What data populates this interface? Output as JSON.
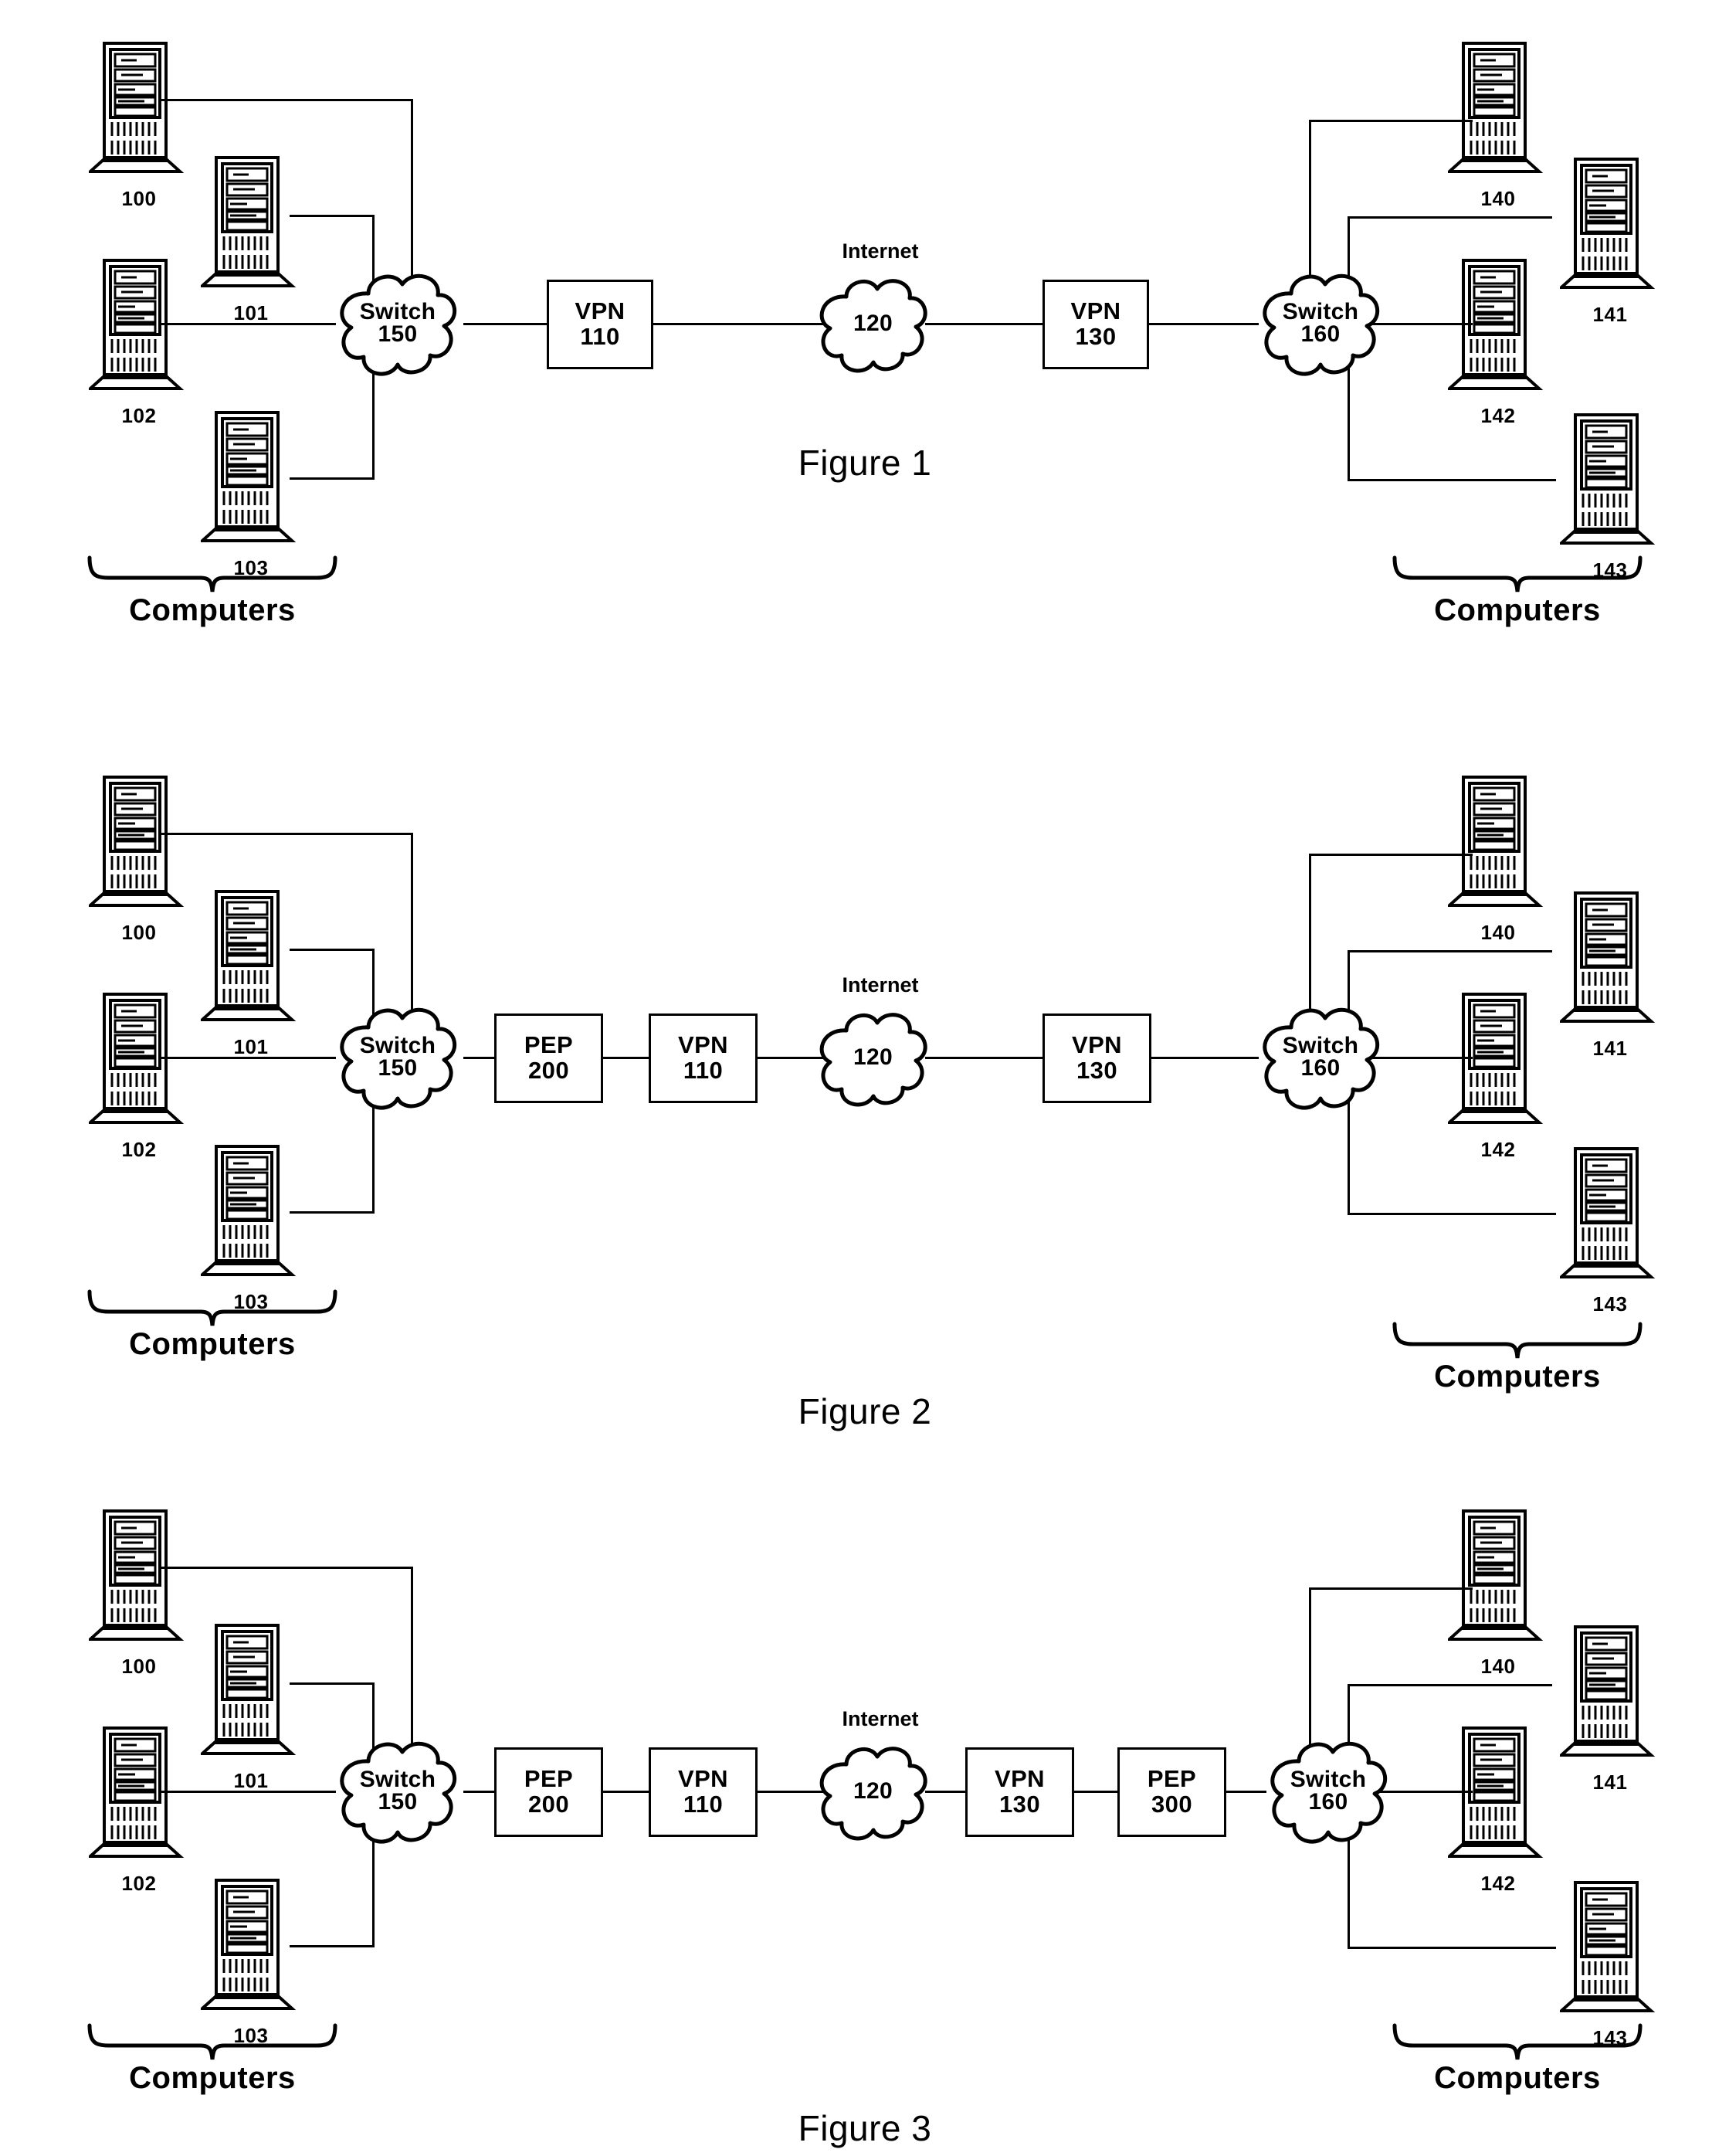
{
  "document": {
    "type": "patent-figure-sheet",
    "figure_count": 3
  },
  "labels": {
    "computers_group": "Computers",
    "internet_caption": "Internet",
    "switch_word": "Switch",
    "vpn_word": "VPN",
    "pep_word": "PEP"
  },
  "figures": [
    {
      "id": "fig1",
      "caption": "Figure 1",
      "left_computers": [
        {
          "ref": "100"
        },
        {
          "ref": "101"
        },
        {
          "ref": "102"
        },
        {
          "ref": "103"
        }
      ],
      "right_computers": [
        {
          "ref": "140"
        },
        {
          "ref": "141"
        },
        {
          "ref": "142"
        },
        {
          "ref": "143"
        }
      ],
      "left_group_label": "Computers",
      "right_group_label": "Computers",
      "chain": [
        {
          "kind": "cloud",
          "line1": "Switch",
          "line2": "150"
        },
        {
          "kind": "box",
          "line1": "VPN",
          "line2": "110"
        },
        {
          "kind": "cloud",
          "line1": "",
          "line2": "120",
          "caption": "Internet"
        },
        {
          "kind": "box",
          "line1": "VPN",
          "line2": "130"
        },
        {
          "kind": "cloud",
          "line1": "Switch",
          "line2": "160"
        }
      ]
    },
    {
      "id": "fig2",
      "caption": "Figure 2",
      "left_computers": [
        {
          "ref": "100"
        },
        {
          "ref": "101"
        },
        {
          "ref": "102"
        },
        {
          "ref": "103"
        }
      ],
      "right_computers": [
        {
          "ref": "140"
        },
        {
          "ref": "141"
        },
        {
          "ref": "142"
        },
        {
          "ref": "143"
        }
      ],
      "left_group_label": "Computers",
      "right_group_label": "Computers",
      "chain": [
        {
          "kind": "cloud",
          "line1": "Switch",
          "line2": "150"
        },
        {
          "kind": "box",
          "line1": "PEP",
          "line2": "200"
        },
        {
          "kind": "box",
          "line1": "VPN",
          "line2": "110"
        },
        {
          "kind": "cloud",
          "line1": "",
          "line2": "120",
          "caption": "Internet"
        },
        {
          "kind": "box",
          "line1": "VPN",
          "line2": "130"
        },
        {
          "kind": "cloud",
          "line1": "Switch",
          "line2": "160"
        }
      ]
    },
    {
      "id": "fig3",
      "caption": "Figure 3",
      "left_computers": [
        {
          "ref": "100"
        },
        {
          "ref": "101"
        },
        {
          "ref": "102"
        },
        {
          "ref": "103"
        }
      ],
      "right_computers": [
        {
          "ref": "140"
        },
        {
          "ref": "141"
        },
        {
          "ref": "142"
        },
        {
          "ref": "143"
        }
      ],
      "left_group_label": "Computers",
      "right_group_label": "Computers",
      "chain": [
        {
          "kind": "cloud",
          "line1": "Switch",
          "line2": "150"
        },
        {
          "kind": "box",
          "line1": "PEP",
          "line2": "200"
        },
        {
          "kind": "box",
          "line1": "VPN",
          "line2": "110"
        },
        {
          "kind": "cloud",
          "line1": "",
          "line2": "120",
          "caption": "Internet"
        },
        {
          "kind": "box",
          "line1": "VPN",
          "line2": "130"
        },
        {
          "kind": "box",
          "line1": "PEP",
          "line2": "300"
        },
        {
          "kind": "cloud",
          "line1": "Switch",
          "line2": "160"
        }
      ]
    }
  ],
  "colors": {
    "ink": "#000000",
    "paper": "#ffffff"
  }
}
